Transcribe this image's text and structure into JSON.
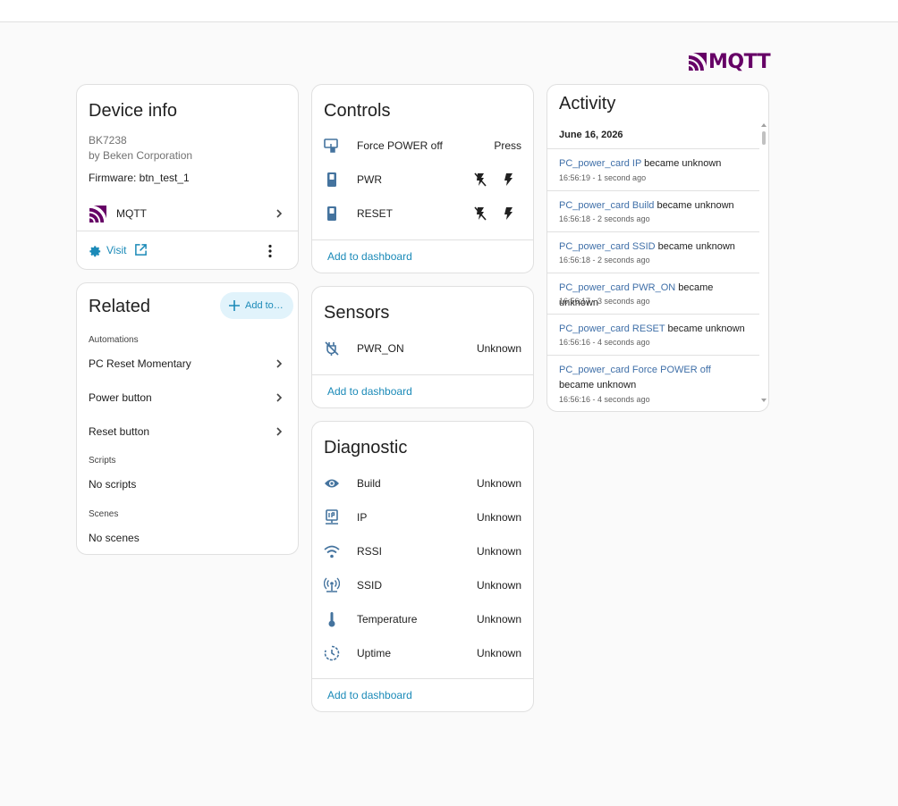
{
  "brand": {
    "name": "MQTT",
    "color": "#660066",
    "logo_icon": "mqtt-logo-icon"
  },
  "device_info": {
    "title": "Device info",
    "model": "BK7238",
    "manufacturer": "by Beken Corporation",
    "firmware": "Firmware: btn_test_1",
    "integration": {
      "label": "MQTT",
      "icon": "mqtt-logo-icon"
    },
    "visit_label": "Visit",
    "visit_icon": "gear-icon",
    "open_icon": "open-in-new-icon",
    "more_icon": "dots-vertical-icon"
  },
  "related": {
    "title": "Related",
    "add_label": "Add to…",
    "automations_header": "Automations",
    "automations": [
      {
        "label": "PC Reset Momentary"
      },
      {
        "label": "Power button"
      },
      {
        "label": "Reset button"
      }
    ],
    "scripts_header": "Scripts",
    "scripts_empty": "No scripts",
    "scenes_header": "Scenes",
    "scenes_empty": "No scenes"
  },
  "controls": {
    "title": "Controls",
    "items": [
      {
        "label": "Force POWER off",
        "action": "Press",
        "icon": "gesture-tap-button-icon"
      },
      {
        "label": "PWR",
        "icon": "light-switch-icon",
        "off_icon": "flash-off-icon",
        "on_icon": "flash-icon"
      },
      {
        "label": "RESET",
        "icon": "light-switch-icon",
        "off_icon": "flash-off-icon",
        "on_icon": "flash-icon"
      }
    ],
    "add_to_dashboard": "Add to dashboard"
  },
  "sensors": {
    "title": "Sensors",
    "items": [
      {
        "label": "PWR_ON",
        "value": "Unknown",
        "icon": "power-plug-off-icon"
      }
    ],
    "add_to_dashboard": "Add to dashboard"
  },
  "diagnostic": {
    "title": "Diagnostic",
    "items": [
      {
        "label": "Build",
        "value": "Unknown",
        "icon": "eye-icon"
      },
      {
        "label": "IP",
        "value": "Unknown",
        "icon": "ip-network-icon"
      },
      {
        "label": "RSSI",
        "value": "Unknown",
        "icon": "wifi-icon"
      },
      {
        "label": "SSID",
        "value": "Unknown",
        "icon": "access-point-icon"
      },
      {
        "label": "Temperature",
        "value": "Unknown",
        "icon": "thermometer-icon"
      },
      {
        "label": "Uptime",
        "value": "Unknown",
        "icon": "timer-icon"
      }
    ],
    "add_to_dashboard": "Add to dashboard"
  },
  "activity": {
    "title": "Activity",
    "date": "June 16, 2026",
    "entries": [
      {
        "entity": "PC_power_card IP",
        "text": " became unknown",
        "time": "16:56:19 - 1 second ago"
      },
      {
        "entity": "PC_power_card Build",
        "text": " became unknown",
        "time": "16:56:18 - 2 seconds ago"
      },
      {
        "entity": "PC_power_card SSID",
        "text": " became unknown",
        "time": "16:56:18 - 2 seconds ago"
      },
      {
        "entity": "PC_power_card PWR_ON",
        "text": " became unknown",
        "time": "16:56:17 - 3 seconds ago"
      },
      {
        "entity": "PC_power_card RESET",
        "text": " became unknown",
        "time": "16:56:16 - 4 seconds ago"
      },
      {
        "entity": "PC_power_card Force POWER off",
        "text": " became unknown",
        "time": "16:56:16 - 4 seconds ago"
      }
    ]
  },
  "colors": {
    "accent": "#1b8ab8",
    "icon": "#44739e",
    "card_border": "#e0e0e0",
    "page_bg": "#fafafa"
  }
}
